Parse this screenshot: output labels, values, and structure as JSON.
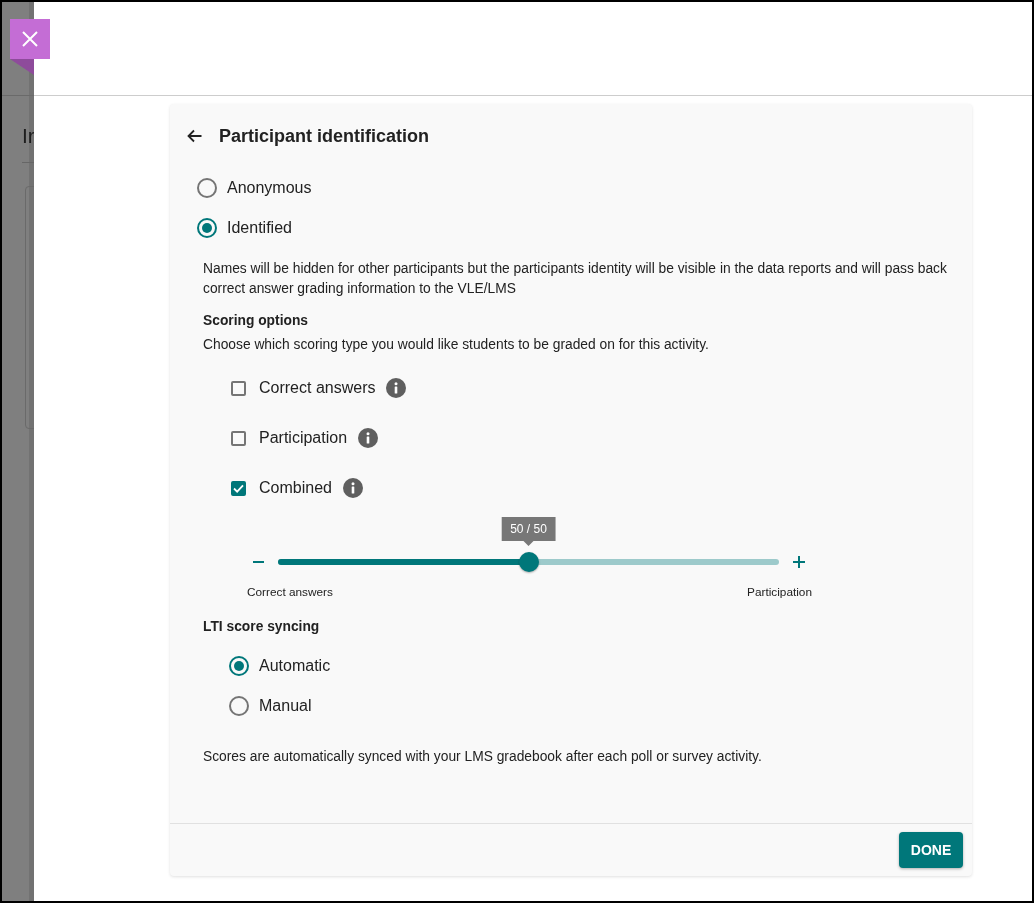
{
  "background_page": {
    "heading": "Ir"
  },
  "settings_panel": {
    "title": "Participant identification",
    "identification_options": [
      {
        "label": "Anonymous",
        "selected": false
      },
      {
        "label": "Identified",
        "selected": true
      }
    ],
    "identified_description": "Names will be hidden for other participants but the participants identity will be visible in the data reports and will pass back correct answer grading information to the VLE/LMS",
    "scoring": {
      "heading": "Scoring options",
      "instructions": "Choose which scoring type you would like students to be graded on for this activity.",
      "options": [
        {
          "label": "Correct answers",
          "checked": false
        },
        {
          "label": "Participation",
          "checked": false
        },
        {
          "label": "Combined",
          "checked": true
        }
      ],
      "weighting_slider": {
        "tooltip": "50 / 50",
        "level": 0.5,
        "min_label": "Correct answers",
        "max_label": "Participation"
      }
    },
    "lti_sync": {
      "heading": "LTI score syncing",
      "options": [
        {
          "label": "Automatic",
          "selected": true
        },
        {
          "label": "Manual",
          "selected": false
        }
      ],
      "note": "Scores are automatically synced with your LMS gradebook after each poll or survey activity."
    },
    "done_button": "DONE"
  }
}
